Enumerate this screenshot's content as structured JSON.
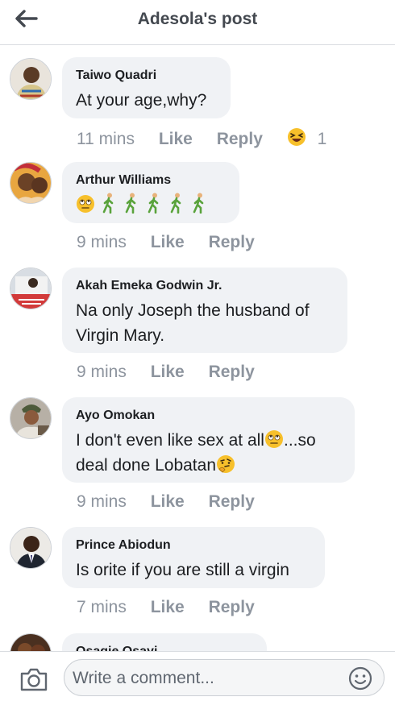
{
  "header": {
    "title": "Adesola's post"
  },
  "comments": [
    {
      "author": "Taiwo Quadri",
      "text": "At your age,why?",
      "time": "11 mins",
      "like": "Like",
      "reply": "Reply",
      "reaction_count": "1"
    },
    {
      "author": "Arthur Williams",
      "text": "",
      "time": "9 mins",
      "like": "Like",
      "reply": "Reply"
    },
    {
      "author": "Akah Emeka Godwin Jr.",
      "text_line1": "Na only Joseph the husband of",
      "text_line2": "Virgin Mary.",
      "time": "9 mins",
      "like": "Like",
      "reply": "Reply"
    },
    {
      "author": "Ayo Omokan",
      "text_line1": "I don't even like sex at all",
      "text_line1_end": "...so",
      "text_line2": "deal done Lobatan",
      "time": "9 mins",
      "like": "Like",
      "reply": "Reply"
    },
    {
      "author": "Prince Abiodun",
      "text": "Is orite if you are still a virgin",
      "time": "7 mins",
      "like": "Like",
      "reply": "Reply"
    },
    {
      "author": "Osagie Osayi"
    }
  ],
  "composer": {
    "placeholder": "Write a comment..."
  },
  "icons": {
    "back": "arrow-left-icon",
    "camera": "camera-icon",
    "smiley": "smiley-icon"
  },
  "colors": {
    "bubble": "#f0f2f5",
    "muted": "#8d949e",
    "title": "#444950"
  }
}
